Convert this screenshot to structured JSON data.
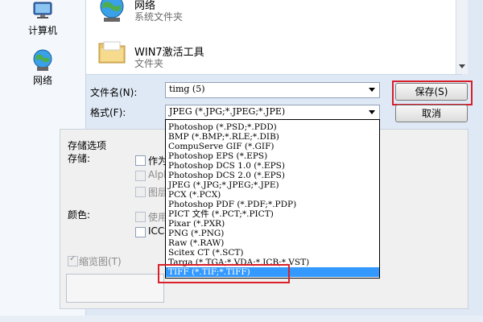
{
  "places": [
    {
      "label": "计算机",
      "icon": "computer-icon"
    },
    {
      "label": "网络",
      "icon": "network-icon"
    }
  ],
  "files": [
    {
      "name": "网络",
      "type": "系统文件夹",
      "icon": "network-globe-icon"
    },
    {
      "name": "WIN7激活工具",
      "type": "文件夹",
      "icon": "folder-icon"
    }
  ],
  "form": {
    "filename_label": "文件名(N):",
    "filename_value": "timg (5)",
    "format_label": "格式(F):",
    "format_value": "JPEG (*.JPG;*.JPEG;*.JPE)",
    "save_label": "保存(S)",
    "cancel_label": "取消"
  },
  "options": {
    "section_title": "存储选项",
    "storage_label": "存储:",
    "color_label": "颜色:",
    "storage_items": [
      "作为",
      "Alph",
      "图层"
    ],
    "color_items": [
      "使用",
      "ICC"
    ],
    "thumbnail_label": "缩览图(T)"
  },
  "format_options": [
    "Photoshop (*.PSD;*.PDD)",
    "BMP (*.BMP;*.RLE;*.DIB)",
    "CompuServe GIF (*.GIF)",
    "Photoshop EPS (*.EPS)",
    "Photoshop DCS 1.0 (*.EPS)",
    "Photoshop DCS 2.0 (*.EPS)",
    "JPEG (*.JPG;*.JPEG;*.JPE)",
    "PCX (*.PCX)",
    "Photoshop PDF (*.PDF;*.PDP)",
    "PICT 文件 (*.PCT;*.PICT)",
    "Pixar (*.PXR)",
    "PNG (*.PNG)",
    "Raw (*.RAW)",
    "Scitex CT (*.SCT)",
    "Targa (*.TGA;*.VDA;*.ICB;*.VST)",
    "TIFF (*.TIF;*.TIFF)"
  ],
  "selected_format_index": 15,
  "colors": {
    "highlight": "#3399ff",
    "annotation_red": "#d9202a"
  }
}
